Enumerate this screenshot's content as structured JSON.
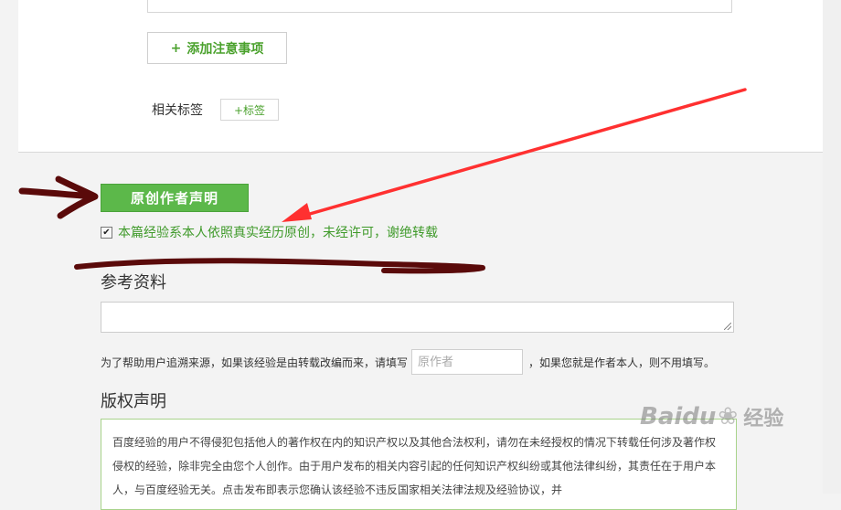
{
  "buttons": {
    "add_note": "添加注意事项",
    "add_note_icon": "+",
    "add_tag": "+标签",
    "original_declaration": "原创作者声明"
  },
  "tags": {
    "label": "相关标签"
  },
  "declaration": {
    "checkbox_mark": "✔",
    "checked": true,
    "text": "本篇经验系本人依照真实经历原创，未经许可，谢绝转载"
  },
  "references": {
    "title": "参考资料",
    "help_before": "为了帮助用户追溯来源，如果该经验是由转载改编而来，请填写",
    "author_placeholder": "原作者",
    "help_after": "，如果您就是作者本人，则不用填写。"
  },
  "copyright": {
    "title": "版权声明",
    "text": "百度经验的用户不得侵犯包括他人的著作权在内的知识产权以及其他合法权利，请勿在未经授权的情况下转载任何涉及著作权侵权的经验，除非完全由您个人创作。由于用户发布的相关内容引起的任何知识产权纠纷或其他法律纠纷，其责任在于用户本人，与百度经验无关。点击发布即表示您确认该经验不违反国家相关法律法规及经验协议，并"
  },
  "watermark": {
    "brand": "Baidu",
    "cn": "经验"
  },
  "colors": {
    "accent_green": "#5cb84a",
    "text_green": "#3f9a2a",
    "annotation_red": "#ff3030",
    "annotation_dark": "#5a0a0a"
  }
}
